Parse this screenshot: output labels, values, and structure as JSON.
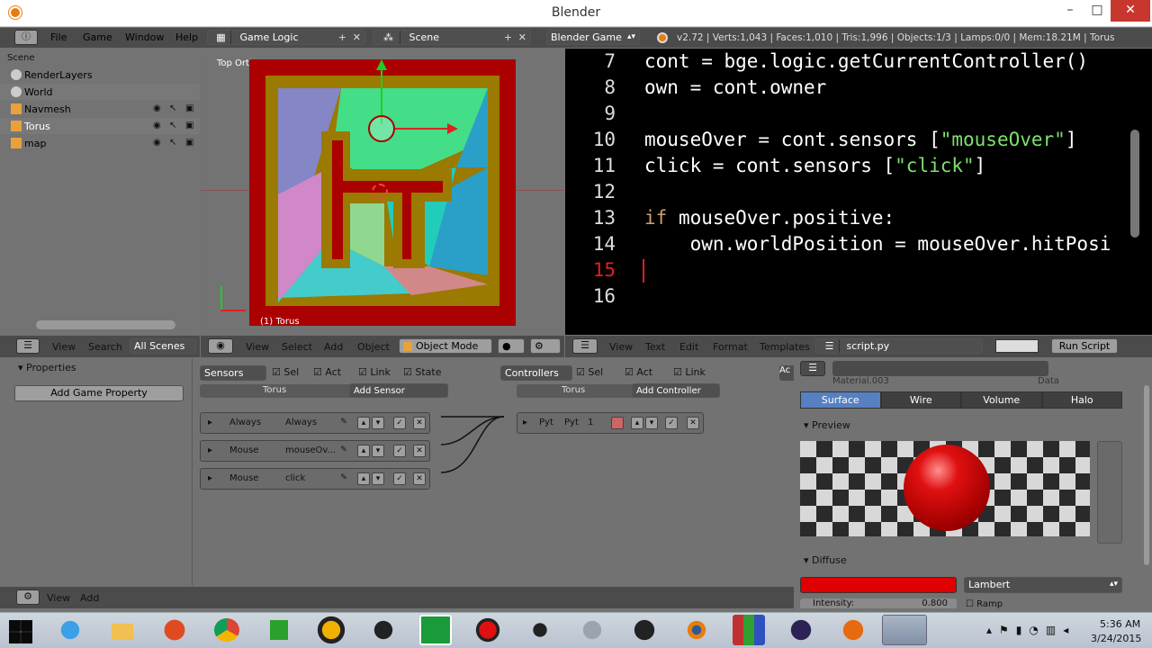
{
  "window": {
    "title": "Blender"
  },
  "info_header": {
    "menus": [
      "File",
      "Game",
      "Window",
      "Help"
    ],
    "screen": "Game Logic",
    "scene": "Scene",
    "engine": "Blender Game",
    "stats": "v2.72 | Verts:1,043 | Faces:1,010 | Tris:1,996 | Objects:1/3 | Lamps:0/0 | Mem:18.21M | Torus"
  },
  "outliner": {
    "root": "Scene",
    "items": [
      {
        "label": "RenderLayers"
      },
      {
        "label": "World"
      },
      {
        "label": "Navmesh"
      },
      {
        "label": "Torus"
      },
      {
        "label": "map"
      }
    ],
    "footer": {
      "view": "View",
      "search": "Search",
      "scenes": "All Scenes"
    }
  },
  "viewport": {
    "label": "Top Ortho",
    "object": "(1) Torus",
    "footer": {
      "view": "View",
      "select": "Select",
      "add": "Add",
      "object": "Object",
      "mode": "Object Mode"
    }
  },
  "text_editor": {
    "lines": [
      {
        "n": "7",
        "segs": [
          {
            "t": "cont = bge.logic.getCurrentController()",
            "c": "w"
          }
        ]
      },
      {
        "n": "8",
        "segs": [
          {
            "t": "own = cont.owner",
            "c": "w"
          }
        ]
      },
      {
        "n": "9",
        "segs": []
      },
      {
        "n": "10",
        "segs": [
          {
            "t": "mouseOver = cont.sensors [",
            "c": "w"
          },
          {
            "t": "\"mouseOver\"",
            "c": "s"
          },
          {
            "t": "]",
            "c": "w"
          }
        ]
      },
      {
        "n": "11",
        "segs": [
          {
            "t": "click = cont.sensors [",
            "c": "w"
          },
          {
            "t": "\"click\"",
            "c": "s"
          },
          {
            "t": "]",
            "c": "w"
          }
        ]
      },
      {
        "n": "12",
        "segs": []
      },
      {
        "n": "13",
        "segs": [
          {
            "t": "if",
            "c": "k"
          },
          {
            "t": " mouseOver.positive:",
            "c": "w"
          }
        ]
      },
      {
        "n": "14",
        "segs": [
          {
            "t": "    own.worldPosition = mouseOver.hitPosi",
            "c": "w"
          }
        ]
      },
      {
        "n": "15",
        "segs": []
      },
      {
        "n": "16",
        "segs": []
      }
    ],
    "current_line": "15",
    "footer": {
      "view": "View",
      "text": "Text",
      "edit": "Edit",
      "format": "Format",
      "templates": "Templates",
      "file": "script.py",
      "run": "Run Script"
    }
  },
  "properties_panel": {
    "title": "Properties",
    "add_btn": "Add Game Property"
  },
  "logic": {
    "sensors": {
      "title": "Sensors",
      "sel": "Sel",
      "act": "Act",
      "link": "Link",
      "state": "State",
      "object": "Torus",
      "add": "Add Sensor",
      "bricks": [
        {
          "type": "Always",
          "name": "Always"
        },
        {
          "type": "Mouse",
          "name": "mouseOv..."
        },
        {
          "type": "Mouse",
          "name": "click"
        }
      ]
    },
    "controllers": {
      "title": "Controllers",
      "sel": "Sel",
      "act": "Act",
      "link": "Link",
      "object": "Torus",
      "add": "Add Controller",
      "brick": {
        "type": "Pyt",
        "name": "Pyt",
        "num": "1"
      }
    },
    "actuators": {
      "title": "Ac"
    },
    "footer": {
      "view": "View",
      "add": "Add"
    }
  },
  "material": {
    "tabs": [
      "Surface",
      "Wire",
      "Volume",
      "Halo"
    ],
    "active_tab": "Surface",
    "slot": "Material.003",
    "data": "Data",
    "preview": "Preview",
    "diffuse": "Diffuse",
    "shader": "Lambert",
    "intensity_label": "Intensity:",
    "intensity": "0.800",
    "ramp": "Ramp",
    "diffuse_color": "#e00000"
  },
  "taskbar": {
    "time": "5:36 AM",
    "date": "3/24/2015"
  },
  "colors": {
    "code_bg": "#000000",
    "string": "#7ee06e",
    "keyword": "#d0a070",
    "current_line": "#e02020",
    "blender_bg": "#727272"
  }
}
